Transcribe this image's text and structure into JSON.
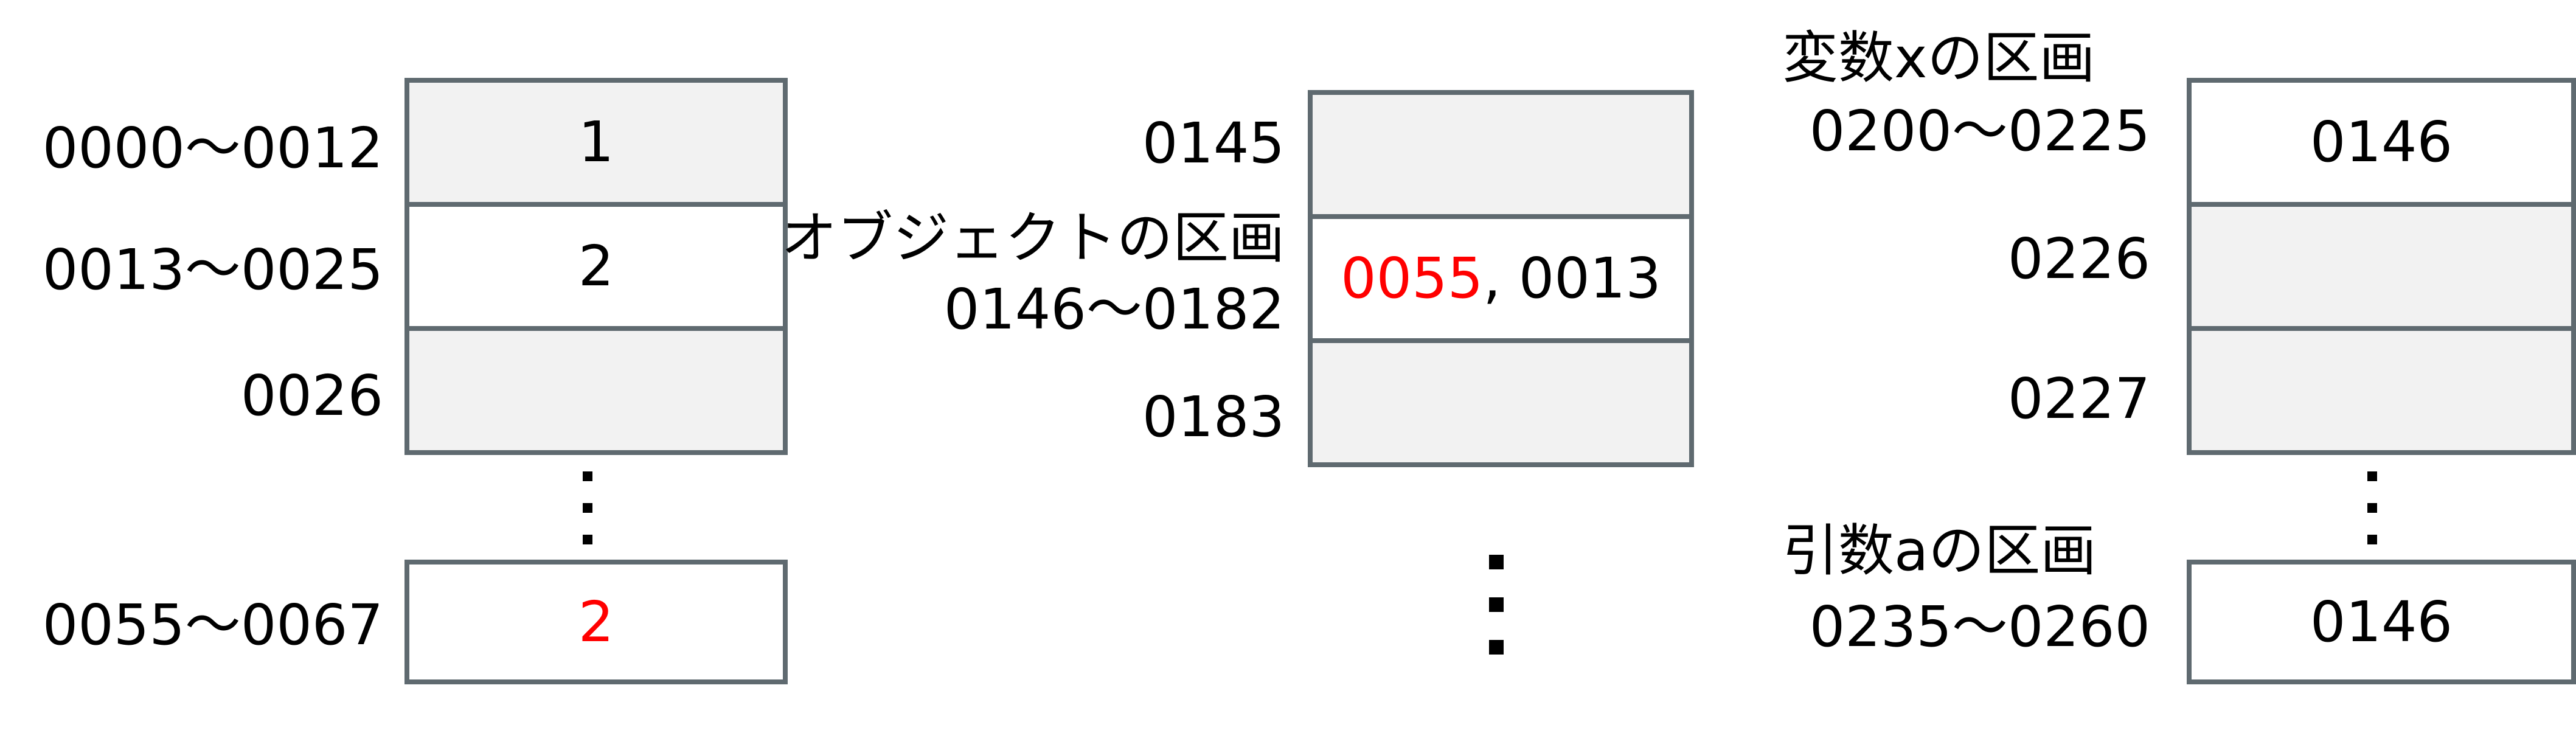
{
  "colors": {
    "highlight": "#ff0000",
    "border": "#5f6a70",
    "shaded_fill": "#f2f2f2",
    "text": "#000000"
  },
  "left_memory": {
    "rows": [
      {
        "address": "0000〜0012",
        "value": "1"
      },
      {
        "address": "0013〜0025",
        "value": "2"
      },
      {
        "address": "0026",
        "value": ""
      },
      {
        "address": "0055〜0067",
        "value": "2"
      }
    ]
  },
  "middle_memory": {
    "object_section_label": "オブジェクトの区画",
    "rows": [
      {
        "address": "0145",
        "value": ""
      },
      {
        "address": "0146〜0182",
        "value_highlight": "0055",
        "value_rest": ", 0013"
      },
      {
        "address": "0183",
        "value": ""
      }
    ]
  },
  "right_memory": {
    "variable_section_label": "変数xの区画",
    "argument_section_label": "引数aの区画",
    "rows": [
      {
        "address": "0200〜0225",
        "value": "0146"
      },
      {
        "address": "0226",
        "value": ""
      },
      {
        "address": "0227",
        "value": ""
      },
      {
        "address": "0235〜0260",
        "value": "0146"
      }
    ]
  }
}
